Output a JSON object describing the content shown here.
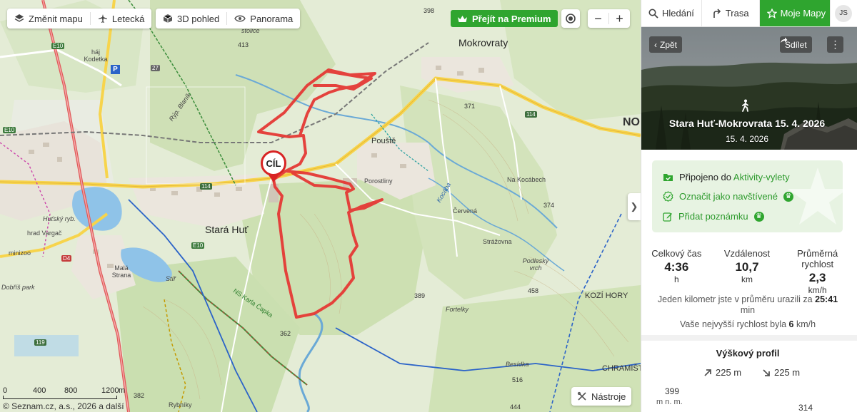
{
  "map": {
    "toolbar": {
      "change_map_label": "Změnit mapu",
      "aerial_label": "Letecká",
      "view_3d_label": "3D pohled",
      "panorama_label": "Panorama"
    },
    "premium_label": "Přejít na Premium",
    "zoom_in_label": "+",
    "zoom_out_label": "−",
    "tools_label": "Nástroje",
    "collapse_label": "❯",
    "scale": {
      "labels": [
        "0",
        "400",
        "800",
        "1200"
      ],
      "unit": "m"
    },
    "copyright": "© Seznam.cz, a.s., 2026 a další",
    "destination_label": "CÍL",
    "labels": {
      "mokrovraty": "Mokrovraty",
      "stara_hut": "Stará Huť",
      "pouste": "Pouště",
      "porostliny": "Porostliny",
      "na_kocabech": "Na Kocábech",
      "cervena": "Červená",
      "strazovna": "Strážovna",
      "podlesky_vrch": "Podleský vrch",
      "kozi_hory": "KOZÍ HORY",
      "chramiste": "CHRAMIŠT",
      "nov": "NO",
      "mala_strana": "Malá Strana",
      "hut_ryb": "Huťský ryb.",
      "dobris_park": "Dobříš park",
      "hrad_vargac": "hrad Vargač",
      "minizoo": "minizoo",
      "stolice": "stolice",
      "haj_kodetka": "háj Kodetka",
      "fortelky": "Fortelky",
      "besidka": "Besídka",
      "ns_karla_capka": "NS Karla Čapka",
      "kocaba": "Kocába",
      "rybniky": "Rybníky",
      "h398": "398",
      "h413": "413",
      "h371": "371",
      "h374": "374",
      "h389": "389",
      "h458": "458",
      "h362": "362",
      "h382": "382",
      "h516": "516",
      "h444": "444",
      "r114a": "114",
      "r114b": "114",
      "r119": "119",
      "r27": "27",
      "d4": "D4",
      "e10a": "E10",
      "e10b": "E10",
      "e10c": "E10",
      "p_mark": "P",
      "stir": "Stíř",
      "ryp_blanik": "Rýp. Blaník"
    }
  },
  "panel": {
    "tabs": {
      "search": "Hledání",
      "route": "Trasa",
      "my_maps": "Moje Mapy",
      "avatar": "JS"
    },
    "hero": {
      "back_label": "Zpět",
      "share_label": "Sdílet",
      "more_label": "⋮",
      "title": "Stara Huť-Mokrovrata 15. 4. 2026",
      "date": "15. 4. 2026"
    },
    "status": {
      "connected_prefix": "Připojeno do ",
      "connected_link": "Aktivity-vylety",
      "mark_visited": "Označit jako navštívené",
      "add_note": "Přidat poznámku"
    },
    "stats": [
      {
        "label": "Celkový čas",
        "value": "4:36",
        "unit": "h"
      },
      {
        "label": "Vzdálenost",
        "value": "10,7",
        "unit": "km"
      },
      {
        "label": "Průměrná rychlost",
        "value": "2,3",
        "unit": "km/h"
      }
    ],
    "avg_km_prefix": "Jeden kilometr jste v průměru urazili za ",
    "avg_km_value": "25:41",
    "avg_km_unit": "min",
    "max_speed_prefix": "Vaše nejvyšší rychlost byla ",
    "max_speed_value": "6",
    "max_speed_unit": " km/h",
    "profile": {
      "title": "Výškový profil",
      "ascent": "225 m",
      "descent": "225 m",
      "max_alt": "399",
      "alt_unit": "m n. m.",
      "min_alt": "314"
    }
  },
  "colors": {
    "accent_green": "#2fa52f",
    "route_red": "#e53935",
    "pin_red": "#d82424"
  }
}
